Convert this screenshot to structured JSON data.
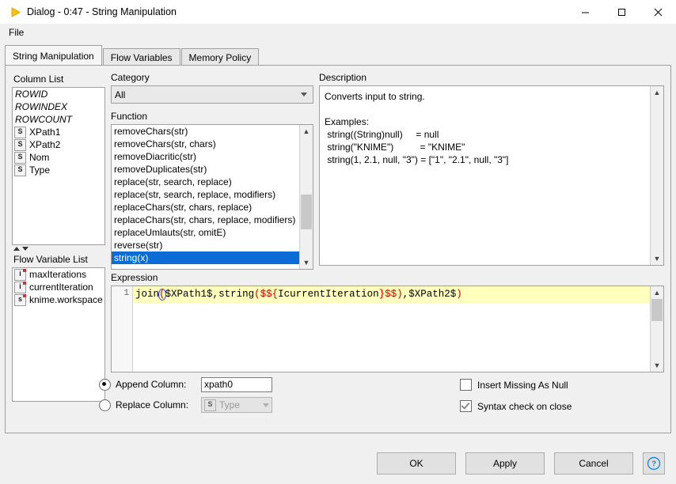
{
  "window": {
    "title": "Dialog - 0:47 - String Manipulation",
    "icon": "knime-triangle-icon",
    "minimize": "—",
    "maximize": "□",
    "close": "✕"
  },
  "menubar": {
    "items": [
      "File"
    ]
  },
  "tabs": [
    {
      "label": "String Manipulation",
      "active": true
    },
    {
      "label": "Flow Variables",
      "active": false
    },
    {
      "label": "Memory Policy",
      "active": false
    }
  ],
  "column_list": {
    "header": "Column List",
    "items": [
      {
        "label": "ROWID",
        "italic": true,
        "icon": ""
      },
      {
        "label": "ROWINDEX",
        "italic": true,
        "icon": ""
      },
      {
        "label": "ROWCOUNT",
        "italic": true,
        "icon": ""
      },
      {
        "label": "XPath1",
        "italic": false,
        "icon": "S"
      },
      {
        "label": "XPath2",
        "italic": false,
        "icon": "S"
      },
      {
        "label": "Nom",
        "italic": false,
        "icon": "S"
      },
      {
        "label": "Type",
        "italic": false,
        "icon": "S"
      }
    ]
  },
  "flow_variable_list": {
    "header": "Flow Variable List",
    "items": [
      {
        "label": "maxIterations",
        "icon": "i"
      },
      {
        "label": "currentIteration",
        "icon": "i"
      },
      {
        "label": "knime.workspace",
        "icon": "s"
      }
    ]
  },
  "category": {
    "label": "Category",
    "value": "All"
  },
  "function": {
    "label": "Function",
    "items": [
      "removeChars(str)",
      "removeChars(str, chars)",
      "removeDiacritic(str)",
      "removeDuplicates(str)",
      "replace(str, search, replace)",
      "replace(str, search, replace, modifiers)",
      "replaceChars(str, chars, replace)",
      "replaceChars(str, chars, replace, modifiers)",
      "replaceUmlauts(str, omitE)",
      "reverse(str)",
      "string(x)"
    ],
    "selected": "string(x)"
  },
  "description": {
    "label": "Description",
    "text": "Converts input to string.\n\nExamples:\n string((String)null)     = null\n string(\"KNIME\")          = \"KNIME\"\n string(1, 2.1, null, \"3\") = [\"1\", \"2.1\", null, \"3\"]"
  },
  "expression": {
    "label": "Expression",
    "line_number": "1",
    "text": "join($XPath1$,string($${IcurrentIteration}$$),$XPath2$)",
    "tokens": {
      "fn_join": "join",
      "paren_open_1": "(",
      "col_xpath1": "$XPath1$",
      "comma_1": ",",
      "fn_string": "string",
      "paren_open_2": "(",
      "var_open": "$${",
      "var_name": "IcurrentIteration",
      "var_close": "}$$",
      "paren_close_1": ")",
      "comma_2": ",",
      "col_xpath2": "$XPath2$",
      "paren_close_2": ")"
    }
  },
  "options": {
    "append": {
      "label": "Append Column:",
      "value": "xpath0",
      "selected": true
    },
    "replace": {
      "label": "Replace Column:",
      "value": "Type",
      "icon": "S",
      "selected": false,
      "disabled": true
    },
    "insert_missing": {
      "label": "Insert Missing As Null",
      "checked": false
    },
    "syntax_check": {
      "label": "Syntax check on close",
      "checked": true
    }
  },
  "footer": {
    "ok": "OK",
    "apply": "Apply",
    "cancel": "Cancel",
    "help": "?"
  },
  "colors": {
    "selection_blue": "#0a6cd4",
    "code_background": "#ffffbe",
    "syntax_red": "#d40000",
    "bracket_match": "#3a3aff"
  }
}
